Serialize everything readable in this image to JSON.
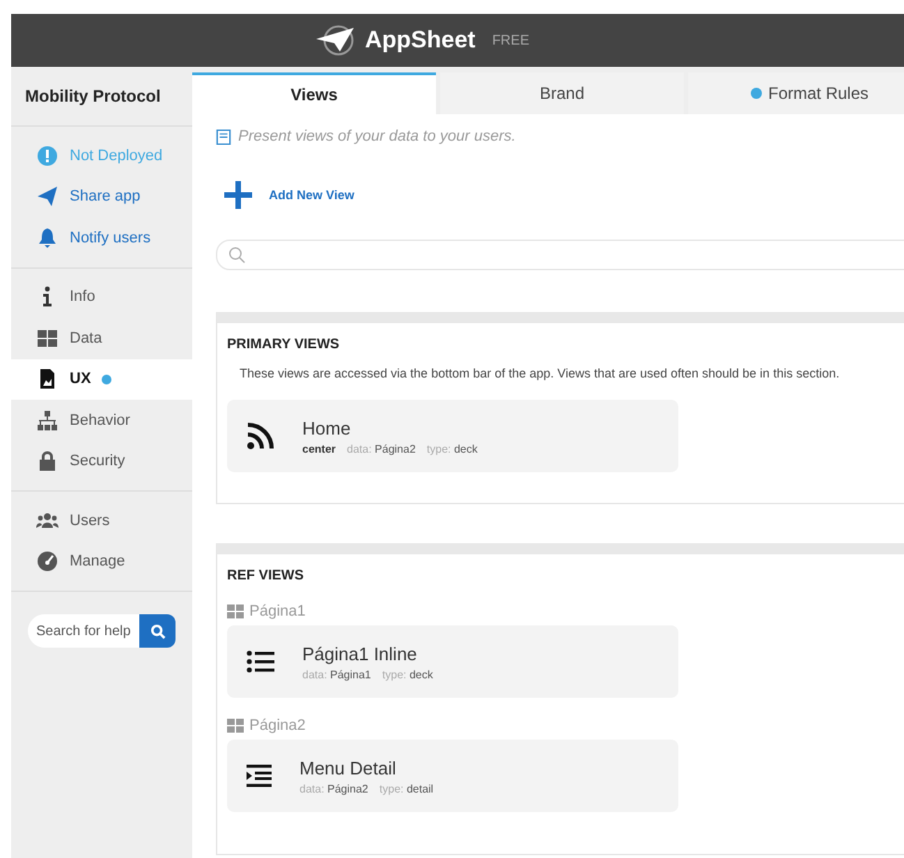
{
  "header": {
    "brand": "AppSheet",
    "plan": "FREE"
  },
  "sidebar": {
    "app_name": "Mobility Protocol",
    "groups": [
      [
        {
          "label": "Not Deployed",
          "kind": "status",
          "selected": false,
          "dot": false
        },
        {
          "label": "Share app",
          "kind": "action",
          "selected": false,
          "dot": false
        },
        {
          "label": "Notify users",
          "kind": "action",
          "selected": false,
          "dot": false
        }
      ],
      [
        {
          "label": "Info",
          "kind": "nav",
          "selected": false,
          "dot": false
        },
        {
          "label": "Data",
          "kind": "nav",
          "selected": false,
          "dot": false
        },
        {
          "label": "UX",
          "kind": "nav",
          "selected": true,
          "dot": true
        },
        {
          "label": "Behavior",
          "kind": "nav",
          "selected": false,
          "dot": false
        },
        {
          "label": "Security",
          "kind": "nav",
          "selected": false,
          "dot": false
        }
      ],
      [
        {
          "label": "Users",
          "kind": "nav",
          "selected": false,
          "dot": false
        },
        {
          "label": "Manage",
          "kind": "nav",
          "selected": false,
          "dot": false
        }
      ]
    ],
    "help_search": {
      "placeholder": "Search for help"
    }
  },
  "tabs": [
    {
      "label": "Views",
      "selected": true,
      "dot": false
    },
    {
      "label": "Brand",
      "selected": false,
      "dot": false
    },
    {
      "label": "Format Rules",
      "selected": false,
      "dot": true
    }
  ],
  "intro": "Present views of your data to your users.",
  "add_button": "Add New View",
  "primary": {
    "title": "PRIMARY VIEWS",
    "description": "These views are accessed via the bottom bar of the app. Views that are used often should be in this section.",
    "views": [
      {
        "name": "Home",
        "position": "center",
        "meta": [
          {
            "label": "data:",
            "value": "Página2"
          },
          {
            "label": "type:",
            "value": "deck"
          }
        ]
      }
    ]
  },
  "ref": {
    "title": "REF VIEWS",
    "groups": [
      {
        "table": "Página1",
        "views": [
          {
            "name": "Página1 Inline",
            "meta": [
              {
                "label": "data:",
                "value": "Página1"
              },
              {
                "label": "type:",
                "value": "deck"
              }
            ]
          }
        ]
      },
      {
        "table": "Página2",
        "views": [
          {
            "name": "Menu Detail",
            "meta": [
              {
                "label": "data:",
                "value": "Página2"
              },
              {
                "label": "type:",
                "value": "detail"
              }
            ]
          }
        ]
      }
    ]
  }
}
